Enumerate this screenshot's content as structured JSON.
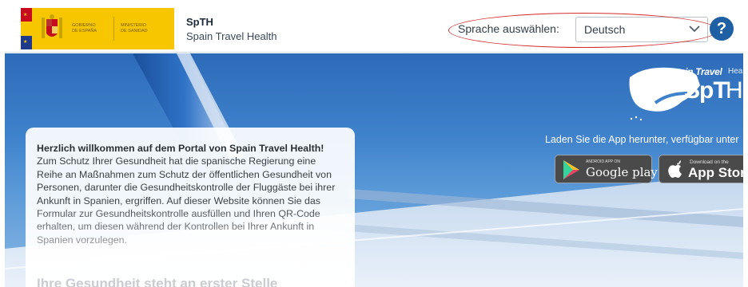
{
  "header": {
    "government_lines": [
      "Gobierno",
      "de España"
    ],
    "ministry_lines": [
      "Ministerio",
      "de Sanidad"
    ],
    "app_title": "SpTH",
    "app_subtitle": "Spain Travel Health",
    "language_label": "Sprache auswählen:",
    "language_value": "Deutsch",
    "help_label": "?"
  },
  "hero": {
    "welcome_bold": "Herzlich willkommen auf dem Portal von Spain Travel Health!",
    "welcome_body": "Zum Schutz Ihrer Gesundheit hat die spanische Regierung eine Reihe an Maßnahmen zum Schutz der öffentlichen Gesundheit von Personen, darunter die Gesundheitskontrolle der Fluggäste bei ihrer Ankunft in Spanien, ergriffen. Auf dieser Website können Sie das Formular zur Gesundheitskontrolle ausfüllen und Ihren QR-Code erhalten, um diesen während der Kontrollen bei Ihrer Ankunft in Spanien vorzulegen.",
    "welcome_heading": "Ihre Gesundheit steht an erster Stelle",
    "brand_name": "Spain Travel",
    "brand_suffix": "Healt",
    "brand_mark": "SpT",
    "brand_mark_thin": "H",
    "download_text": "Laden Sie die App herunter, verfügbar unter",
    "google_small": "Android App on",
    "google_big": "Google play",
    "apple_small": "Download on the",
    "apple_big": "App Store"
  },
  "colors": {
    "accent_blue": "#1f5fa3",
    "gov_yellow": "#f6c600",
    "highlight_red": "#d42a2a"
  },
  "icons": [
    "spain-flag-icon",
    "coat-of-arms-icon",
    "chevron-down-icon",
    "help-icon",
    "google-play-icon",
    "apple-icon",
    "spain-map-logo-icon"
  ]
}
